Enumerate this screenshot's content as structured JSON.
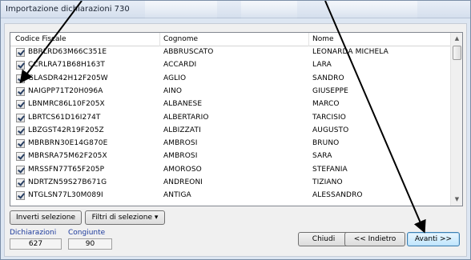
{
  "window": {
    "title": "Importazione dichiarazioni 730"
  },
  "list": {
    "columns": [
      "Codice Fiscale",
      "Cognome",
      "Nome"
    ],
    "rows": [
      {
        "cf": "BBRLRD63M66C351E",
        "cognome": "ABBRUSCATO",
        "nome": "LEONARDA MICHELA"
      },
      {
        "cf": "CCRLRA71B68H163T",
        "cognome": "ACCARDI",
        "nome": "LARA"
      },
      {
        "cf": "GLASDR42H12F205W",
        "cognome": "AGLIO",
        "nome": "SANDRO"
      },
      {
        "cf": "NAIGPP71T20H096A",
        "cognome": "AINO",
        "nome": "GIUSEPPE"
      },
      {
        "cf": "LBNMRC86L10F205X",
        "cognome": "ALBANESE",
        "nome": "MARCO"
      },
      {
        "cf": "LBRTCS61D16I274T",
        "cognome": "ALBERTARIO",
        "nome": "TARCISIO"
      },
      {
        "cf": "LBZGST42R19F205Z",
        "cognome": "ALBIZZATI",
        "nome": "AUGUSTO"
      },
      {
        "cf": "MBRBRN30E14G870E",
        "cognome": "AMBROSI",
        "nome": "BRUNO"
      },
      {
        "cf": "MBRSRA75M62F205X",
        "cognome": "AMBROSI",
        "nome": "SARA"
      },
      {
        "cf": "MRSSFN77T65F205P",
        "cognome": "AMOROSO",
        "nome": "STEFANIA"
      },
      {
        "cf": "NDRTZN59S27B671G",
        "cognome": "ANDREONI",
        "nome": "TIZIANO"
      },
      {
        "cf": "NTGLSN77L30M089I",
        "cognome": "ANTIGA",
        "nome": "ALESSANDRO"
      }
    ]
  },
  "toolbar": {
    "invert_label": "Inverti selezione",
    "filter_label": "Filtri di selezione ▾"
  },
  "footer": {
    "dichiarazioni_label": "Dichiarazioni",
    "dichiarazioni_value": "627",
    "congiunte_label": "Congiunte",
    "congiunte_value": "90",
    "close_label": "Chiudi",
    "back_label": "<< Indietro",
    "next_label": "Avanti >>"
  },
  "colors": {
    "accent": "#3c7fb1",
    "link_label": "#1c3a9c",
    "arrow": "#000000"
  },
  "icons": {
    "scroll_up": "chevron-up-icon",
    "scroll_down": "chevron-down-icon",
    "checked": "checkbox-checked-icon"
  }
}
